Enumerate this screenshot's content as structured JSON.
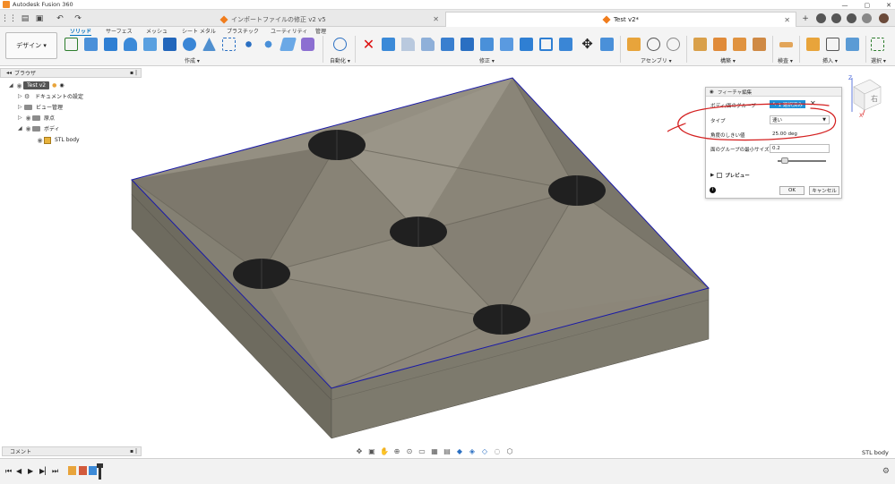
{
  "window": {
    "title": "Autodesk Fusion 360",
    "controls": [
      "—",
      "▢",
      "✕"
    ]
  },
  "tabs": [
    {
      "label": "インポートファイルの修正 v2 v5",
      "active": false
    },
    {
      "label": "Test v2*",
      "active": true
    }
  ],
  "ribbon": {
    "workspace_button": "デザイン ▾",
    "tabs": [
      "ソリッド",
      "サーフェス",
      "メッシュ",
      "シート メタル",
      "プラスチック",
      "ユーティリティ",
      "管理"
    ],
    "groups": [
      "作成 ▾",
      "自動化 ▾",
      "修正 ▾",
      "アセンブリ ▾",
      "構築 ▾",
      "検査 ▾",
      "挿入 ▾",
      "選択 ▾"
    ]
  },
  "browser": {
    "title": "ブラウザ",
    "root": "Test v2",
    "items": [
      "ドキュメントの設定",
      "ビュー管理",
      "原点",
      "ボディ",
      "STL body"
    ]
  },
  "dialog": {
    "title": "フィーチャ編集",
    "body_face_group_label": "ボディ/面のグループ",
    "selection_button": "1 選択済み",
    "type_label": "タイプ",
    "type_value": "速い",
    "angle_label": "角度のしきい値",
    "angle_value": "25.00 deg",
    "min_size_label": "面のグループの最小サイズ",
    "min_size_value": "0.2",
    "slider_value": 0.15,
    "preview_label": "プレビュー",
    "ok": "OK",
    "cancel": "キャンセル"
  },
  "viewcube": {
    "face": "右",
    "axis_z": "Z",
    "axis_x": "X"
  },
  "comment_panel": {
    "title": "コメント"
  },
  "status": {
    "selection_name": "STL body"
  }
}
